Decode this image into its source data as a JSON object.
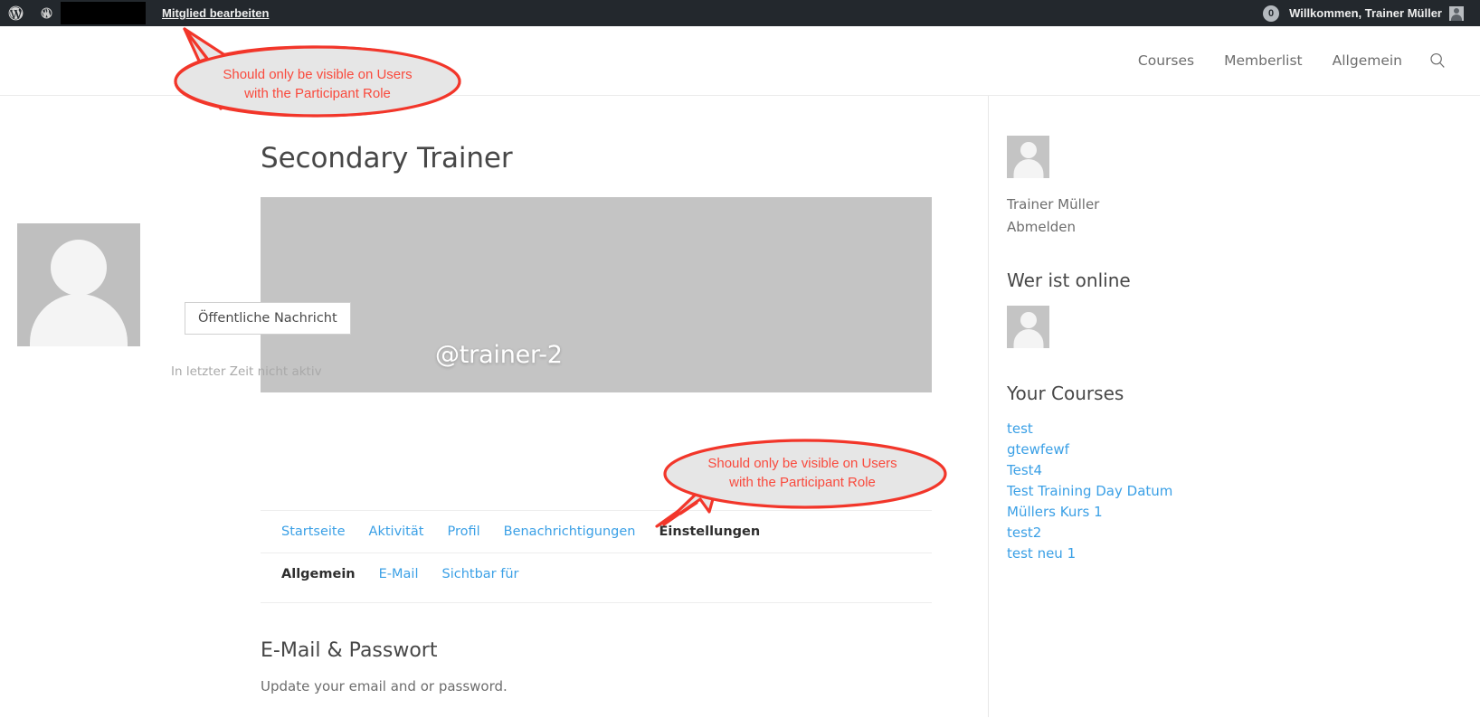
{
  "adminbar": {
    "wp_logo_icon": "wordpress-logo-icon",
    "site_icon": "site-dashboard-icon",
    "redacted_site_name": "",
    "page_link": "Mitglied bearbeiten",
    "comment_count": "0",
    "greeting": "Willkommen, Trainer Müller",
    "avatar_icon": "user-avatar-icon"
  },
  "header": {
    "nav": [
      {
        "label": "Courses"
      },
      {
        "label": "Memberlist"
      },
      {
        "label": "Allgemein"
      }
    ],
    "search_icon": "search-icon"
  },
  "main": {
    "page_title": "Secondary Trainer",
    "cover": {
      "username": "@trainer-2",
      "avatar_icon": "profile-avatar-icon"
    },
    "message_button": "Öffentliche Nachricht",
    "last_active": "In letzter Zeit nicht aktiv",
    "tabs": [
      {
        "label": "Startseite",
        "active": false
      },
      {
        "label": "Aktivität",
        "active": false
      },
      {
        "label": "Profil",
        "active": false
      },
      {
        "label": "Benachrichtigungen",
        "active": false
      },
      {
        "label": "Einstellungen",
        "active": true
      }
    ],
    "subtabs": [
      {
        "label": "Allgemein",
        "active": true
      },
      {
        "label": "E-Mail",
        "active": false
      },
      {
        "label": "Sichtbar für",
        "active": false
      }
    ],
    "section_title": "E-Mail & Passwort",
    "section_desc": "Update your email and or password."
  },
  "sidebar": {
    "user": {
      "avatar_icon": "user-avatar-icon",
      "name": "Trainer Müller",
      "logout_label": "Abmelden"
    },
    "online": {
      "heading": "Wer ist online",
      "avatar_icon": "online-user-avatar-icon"
    },
    "courses": {
      "heading": "Your Courses",
      "items": [
        {
          "label": "test"
        },
        {
          "label": "gtewfewf"
        },
        {
          "label": "Test4"
        },
        {
          "label": "Test Training Day Datum"
        },
        {
          "label": "Müllers Kurs 1"
        },
        {
          "label": "test2"
        },
        {
          "label": "test neu 1"
        }
      ]
    }
  },
  "annotations": [
    {
      "id": "top",
      "line1": "Should only be visible on Users",
      "line2": "with the Participant Role"
    },
    {
      "id": "bottom",
      "line1": "Should only be visible on Users",
      "line2": "with the Participant Role"
    }
  ],
  "colors": {
    "adminbar_bg": "#23282d",
    "link_blue": "#3ba0e6",
    "annotation_red": "#f94a3d",
    "cover_gray": "#c4c4c4"
  }
}
